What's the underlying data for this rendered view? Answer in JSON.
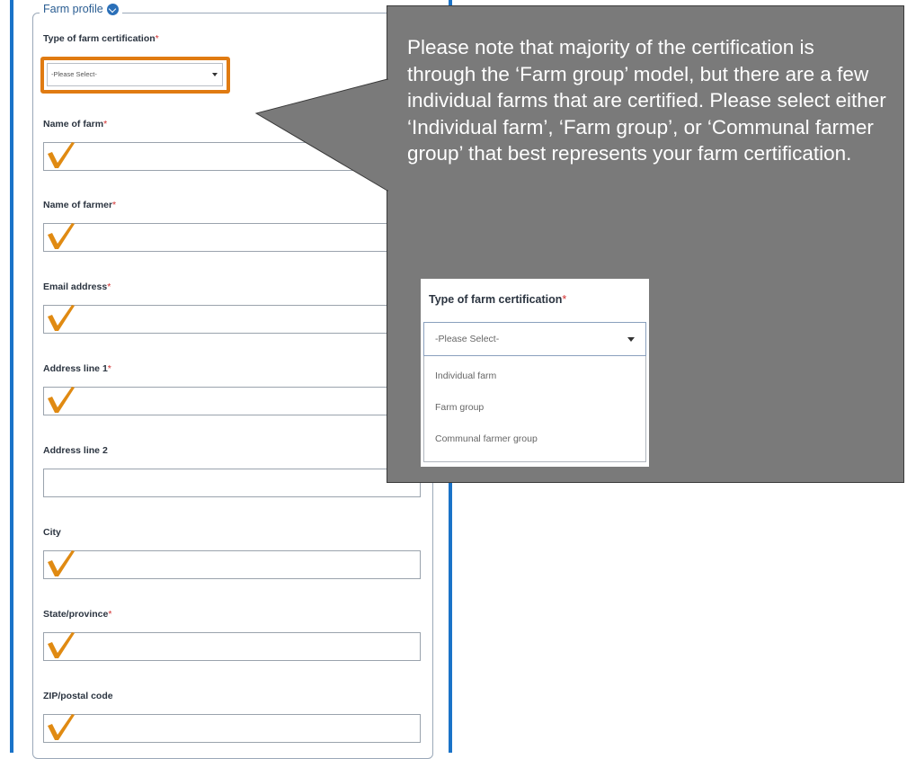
{
  "form": {
    "section_title": "Farm profile",
    "select": {
      "label": "Type of farm certification",
      "required_marker": "*",
      "value": "-Please Select-"
    },
    "fields": [
      {
        "label": "Name of farm",
        "required_marker": "*",
        "value": ""
      },
      {
        "label": "Name of farmer",
        "required_marker": "*",
        "value": ""
      },
      {
        "label": "Email address",
        "required_marker": "*",
        "value": ""
      },
      {
        "label": "Address line 1",
        "required_marker": "*",
        "value": ""
      },
      {
        "label": "Address line 2",
        "required_marker": "",
        "value": ""
      },
      {
        "label": "City",
        "required_marker": "",
        "value": ""
      },
      {
        "label": "State/province",
        "required_marker": "*",
        "value": ""
      },
      {
        "label": "ZIP/postal code",
        "required_marker": "",
        "value": ""
      }
    ]
  },
  "annotation": {
    "text": "Please note that majority of the certification is through the ‘Farm group’ model, but there are a few individual farms that are certified. Please select either ‘Individual farm’, ‘Farm group’, or ‘Communal farmer group’ that best represents your farm certification.",
    "colors": {
      "callout": "#7a7a7a",
      "highlight": "#e07b12",
      "checkmark": "#e08a12"
    }
  },
  "inset": {
    "label": "Type of farm certification",
    "required_marker": "*",
    "selected": "-Please Select-",
    "options": [
      "Individual farm",
      "Farm group",
      "Communal farmer group"
    ]
  },
  "icons": {
    "legend": "chevron-down-icon",
    "check": "checkmark-icon"
  },
  "accent_color": "#1a73c8"
}
